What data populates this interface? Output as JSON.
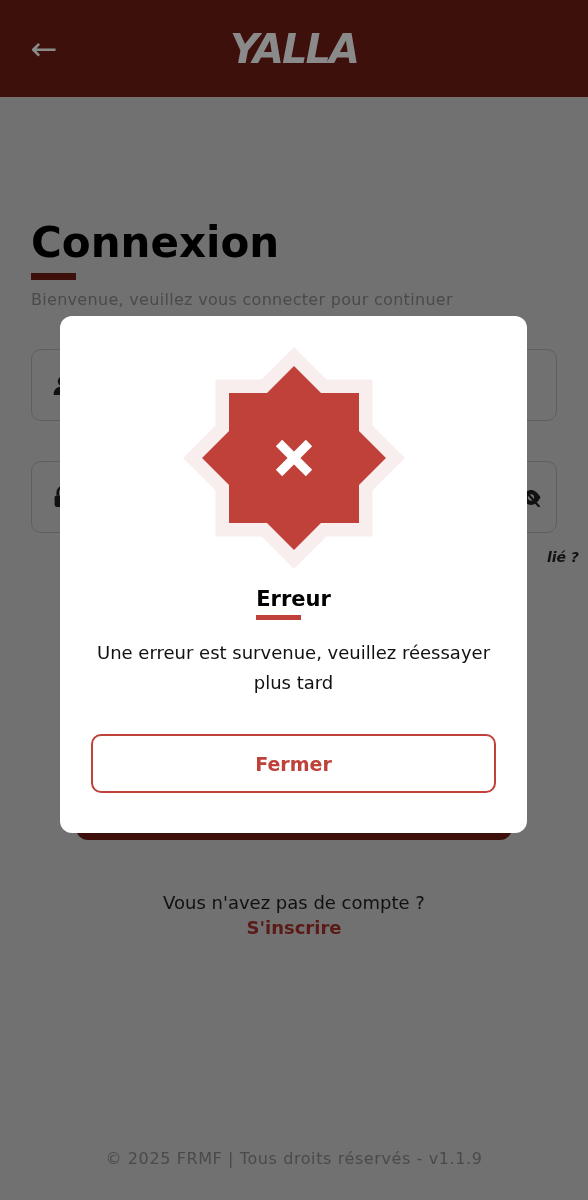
{
  "header": {
    "back": "←",
    "logo": "YALLA"
  },
  "login": {
    "title": "Connexion",
    "subtitle": "Bienvenue, veuillez vous connecter pour continuer",
    "forgot_password": "lié ?",
    "fields": [
      {
        "kind": "user"
      },
      {
        "kind": "password"
      }
    ]
  },
  "signup": {
    "question": "Vous n'avez pas de compte ?",
    "link": "S'inscrire"
  },
  "footer": "© 2025 FRMF | Tous droits réservés - v1.1.9",
  "dialog": {
    "kind": "error",
    "title": "Erreur",
    "message": "Une erreur est survenue, veuillez réessayer plus tard",
    "button": "Fermer"
  }
}
